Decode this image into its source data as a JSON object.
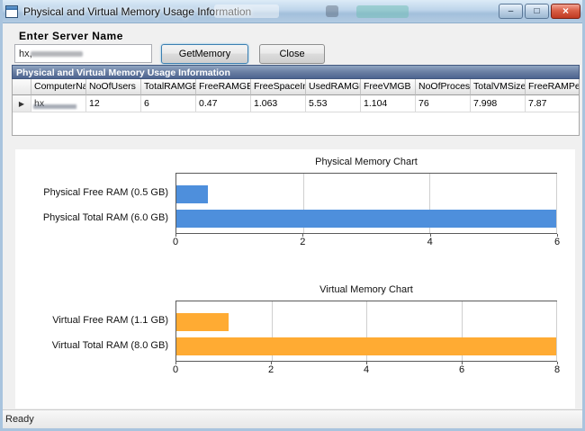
{
  "window": {
    "title": "Physical and Virtual Memory Usage Information",
    "minimize_glyph": "–",
    "maximize_glyph": "□",
    "close_glyph": "×"
  },
  "toolbar": {
    "server_label": "Enter Server Name",
    "server_input_value": "hx,",
    "get_memory_button": "GetMemory",
    "close_button": "Close"
  },
  "section": {
    "header_title": "Physical and Virtual Memory Usage Information"
  },
  "grid": {
    "columns": [
      "ComputerNa",
      "NoOfUsers",
      "TotalRAMGB",
      "FreeRAMGB",
      "FreeSpaceIn",
      "UsedRAMGB",
      "FreeVMGB",
      "NoOfProcess",
      "TotalVMSize",
      "FreeRAMPer"
    ],
    "rows": [
      [
        "hx",
        "12",
        "6",
        "0.47",
        "1.063",
        "5.53",
        "1.104",
        "76",
        "7.998",
        "7.87"
      ]
    ]
  },
  "chart_data": [
    {
      "type": "bar",
      "orientation": "horizontal",
      "title": "Physical Memory Chart",
      "categories": [
        "Physical Free RAM (0.5 GB)",
        "Physical Total RAM (6.0 GB)"
      ],
      "values": [
        0.5,
        6.0
      ],
      "bar_color": "#4E8FDC",
      "xlim": [
        0,
        6
      ],
      "xticks": [
        0,
        2,
        4,
        6
      ],
      "grid": "vertical-only",
      "legend": "none"
    },
    {
      "type": "bar",
      "orientation": "horizontal",
      "title": "Virtual Memory Chart",
      "categories": [
        "Virtual Free RAM (1.1 GB)",
        "Virtual Total RAM (8.0 GB)"
      ],
      "values": [
        1.1,
        8.0
      ],
      "bar_color": "#FFAB33",
      "xlim": [
        0,
        8
      ],
      "xticks": [
        0,
        2,
        4,
        6,
        8
      ],
      "grid": "vertical-only",
      "legend": "none"
    }
  ],
  "statusbar": {
    "text": "Ready"
  },
  "colors": {
    "physical_bar": "#4E8FDC",
    "virtual_bar": "#FFAB33",
    "section_header_top": "#91A6C2",
    "section_header_bottom": "#4D6490",
    "titlebar": "#BDD4EA",
    "close_button_red": "#BF3A22"
  }
}
